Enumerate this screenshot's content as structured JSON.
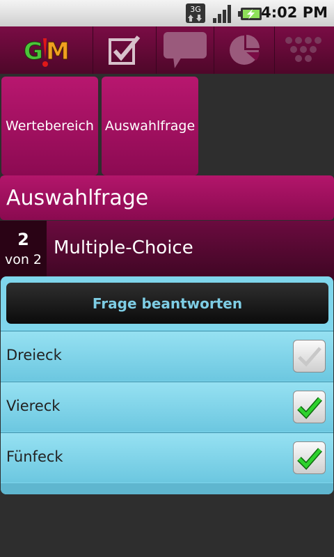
{
  "status": {
    "time": "4:02 PM",
    "network": "3G"
  },
  "toolbar": {
    "logo": "GM",
    "icons": [
      "checkbox-icon",
      "speech-bubble-icon",
      "pie-chart-icon",
      "network-icon"
    ]
  },
  "tiles": [
    "Wertebereich",
    "Auswahlfrage"
  ],
  "question": {
    "heading": "Auswahlfrage",
    "number": "2",
    "of_total": "von 2",
    "type": "Multiple-Choice"
  },
  "panel": {
    "answer_button": "Frage beantworten",
    "options": [
      {
        "label": "Dreieck",
        "checked": false
      },
      {
        "label": "Viereck",
        "checked": true
      },
      {
        "label": "Fünfeck",
        "checked": true
      }
    ]
  },
  "colors": {
    "accent": "#a0125f",
    "panel": "#7fd6ec",
    "button_text": "#7ecde4",
    "check": "#22c722"
  }
}
